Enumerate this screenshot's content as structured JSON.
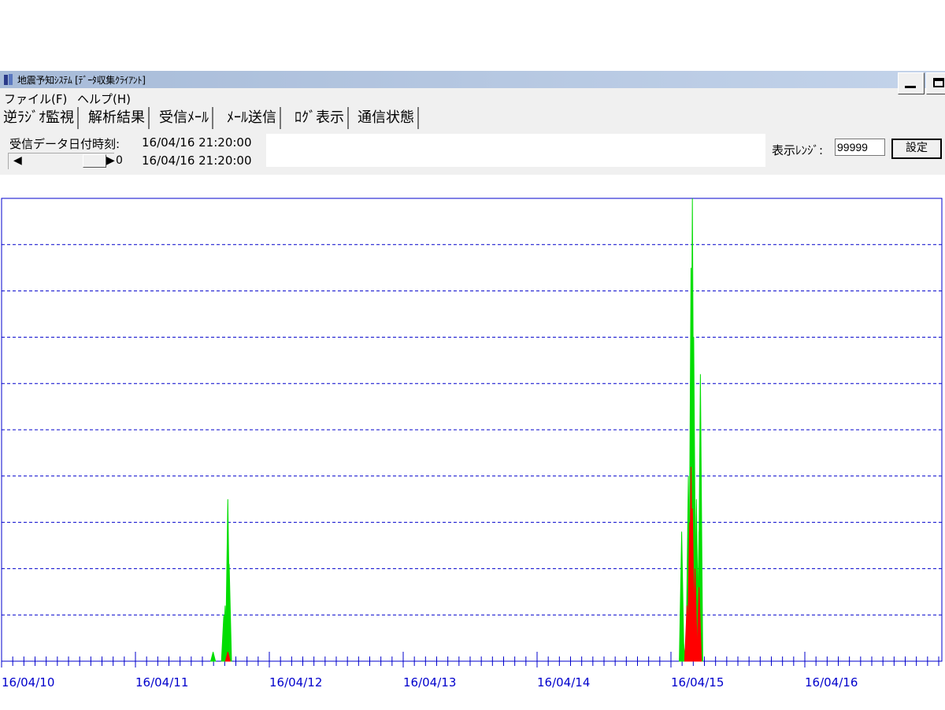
{
  "window": {
    "title": "地震予知ｼｽﾃﾑ [ﾃﾞｰﾀ収集ｸﾗｲｱﾝﾄ]",
    "icon": "app-icon",
    "controls": [
      "minimize-button",
      "maximize-button"
    ]
  },
  "menu": {
    "items": [
      {
        "label": "ファイル(F)"
      },
      {
        "label": "ヘルプ(H)"
      }
    ]
  },
  "tabs": [
    {
      "label": "逆ﾗｼﾞｵ監視",
      "active": true
    },
    {
      "label": "解析結果"
    },
    {
      "label": "受信ﾒｰﾙ"
    },
    {
      "label": "ﾒｰﾙ送信"
    },
    {
      "label": "ﾛｸﾞ表示"
    },
    {
      "label": "通信状態"
    }
  ],
  "info": {
    "received_label": "受信データ日付時刻:",
    "received_value": "16/04/16 21:20:00",
    "scroll_value": "0",
    "scroll_time": "16/04/16 21:20:00",
    "range_label": "表示ﾚﾝｼﾞ:",
    "range_value": "99999",
    "set_button": "設定"
  },
  "chart_data": {
    "type": "area",
    "x_tick_labels": [
      "16/04/10",
      "16/04/11",
      "16/04/12",
      "16/04/13",
      "16/04/14",
      "16/04/15",
      "16/04/16"
    ],
    "series": [
      {
        "color": "#00dd00",
        "peaks": [
          {
            "x": 1.58,
            "y": 0.02
          },
          {
            "x": 1.66,
            "y": 0.1
          },
          {
            "x": 1.67,
            "y": 0.12
          },
          {
            "x": 1.69,
            "y": 0.35
          },
          {
            "x": 1.7,
            "y": 0.21
          },
          {
            "x": 5.08,
            "y": 0.28
          },
          {
            "x": 5.09,
            "y": 0.05
          },
          {
            "x": 5.13,
            "y": 0.4
          },
          {
            "x": 5.15,
            "y": 0.85
          },
          {
            "x": 5.16,
            "y": 1.0
          },
          {
            "x": 5.17,
            "y": 0.7
          },
          {
            "x": 5.19,
            "y": 0.35
          },
          {
            "x": 5.21,
            "y": 0.28
          },
          {
            "x": 5.22,
            "y": 0.62
          }
        ]
      },
      {
        "color": "#ff0000",
        "peaks": [
          {
            "x": 1.69,
            "y": 0.02
          },
          {
            "x": 5.12,
            "y": 0.12
          },
          {
            "x": 5.14,
            "y": 0.3
          },
          {
            "x": 5.15,
            "y": 0.42
          },
          {
            "x": 5.16,
            "y": 0.33
          },
          {
            "x": 5.18,
            "y": 0.2
          },
          {
            "x": 5.21,
            "y": 0.16
          }
        ]
      }
    ],
    "colors": {
      "axis": "#0000cc",
      "grid": "#0000cc",
      "label": "#0000cc"
    },
    "grid": true,
    "gridlines": 10
  }
}
